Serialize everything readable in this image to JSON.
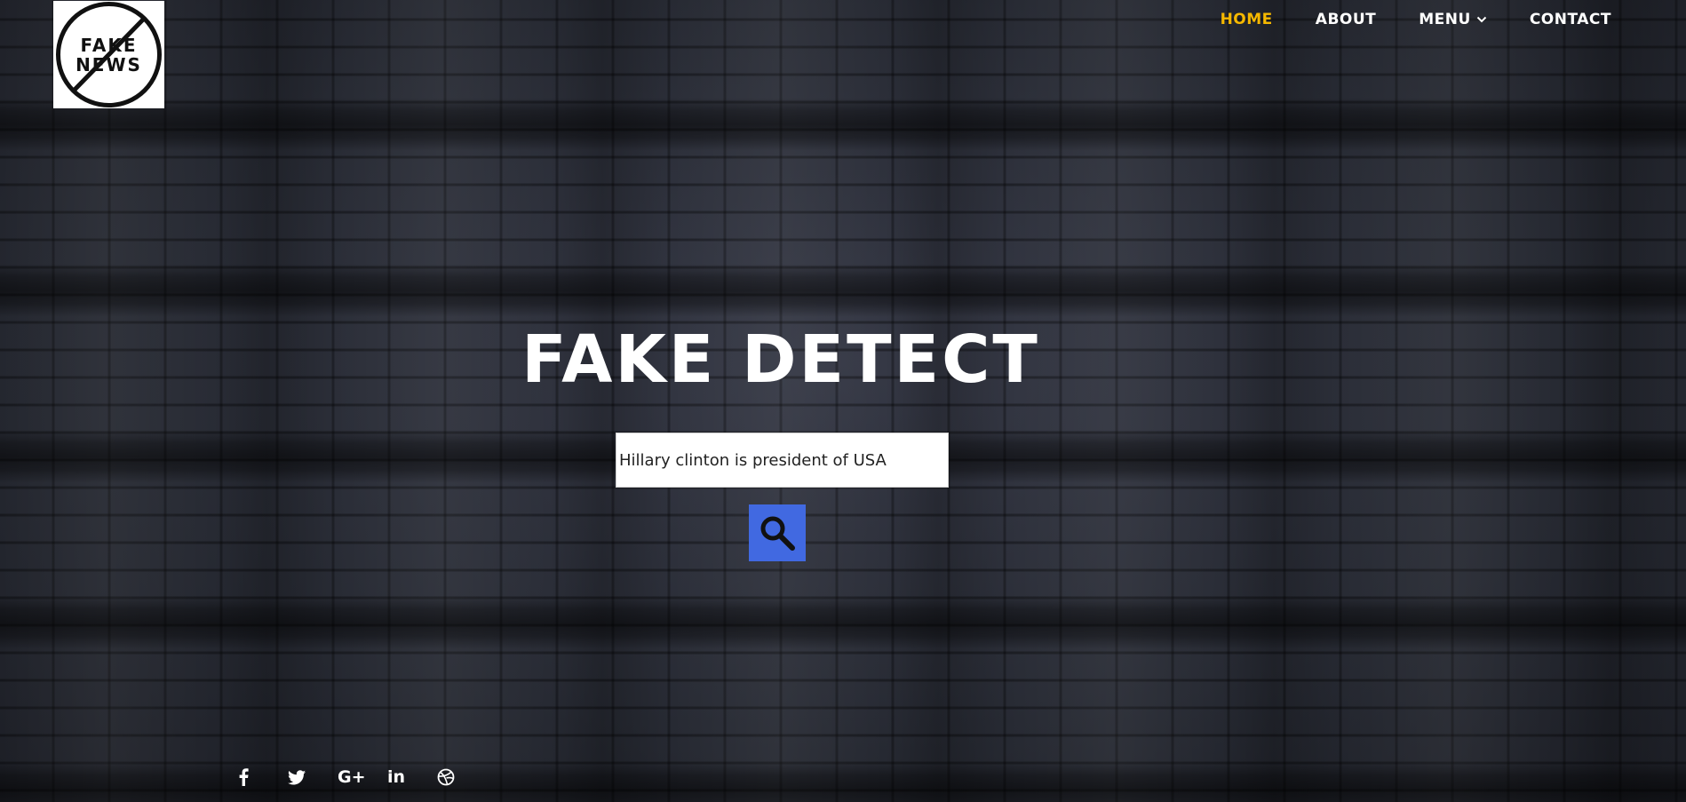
{
  "logo": {
    "text_line1": "FAKE",
    "text_line2": "NEWS",
    "icon": "no-fake-news-logo"
  },
  "nav": {
    "items": [
      {
        "label": "HOME",
        "active": true
      },
      {
        "label": "ABOUT",
        "active": false
      },
      {
        "label": "MENU",
        "active": false,
        "has_dropdown": true
      },
      {
        "label": "CONTACT",
        "active": false
      }
    ]
  },
  "hero": {
    "title": "FAKE DETECT"
  },
  "search": {
    "value": "Hillary clinton is president of USA",
    "button_icon": "search-icon"
  },
  "social": [
    {
      "name": "facebook-icon",
      "glyph": "f"
    },
    {
      "name": "twitter-icon",
      "glyph": ""
    },
    {
      "name": "google-plus-icon",
      "glyph": "G+"
    },
    {
      "name": "linkedin-icon",
      "glyph": "in"
    },
    {
      "name": "dribbble-icon",
      "glyph": ""
    }
  ],
  "colors": {
    "nav_active": "#f5b800",
    "nav_text": "#ffffff",
    "search_button": "#4169e1",
    "background": "#23252d"
  }
}
